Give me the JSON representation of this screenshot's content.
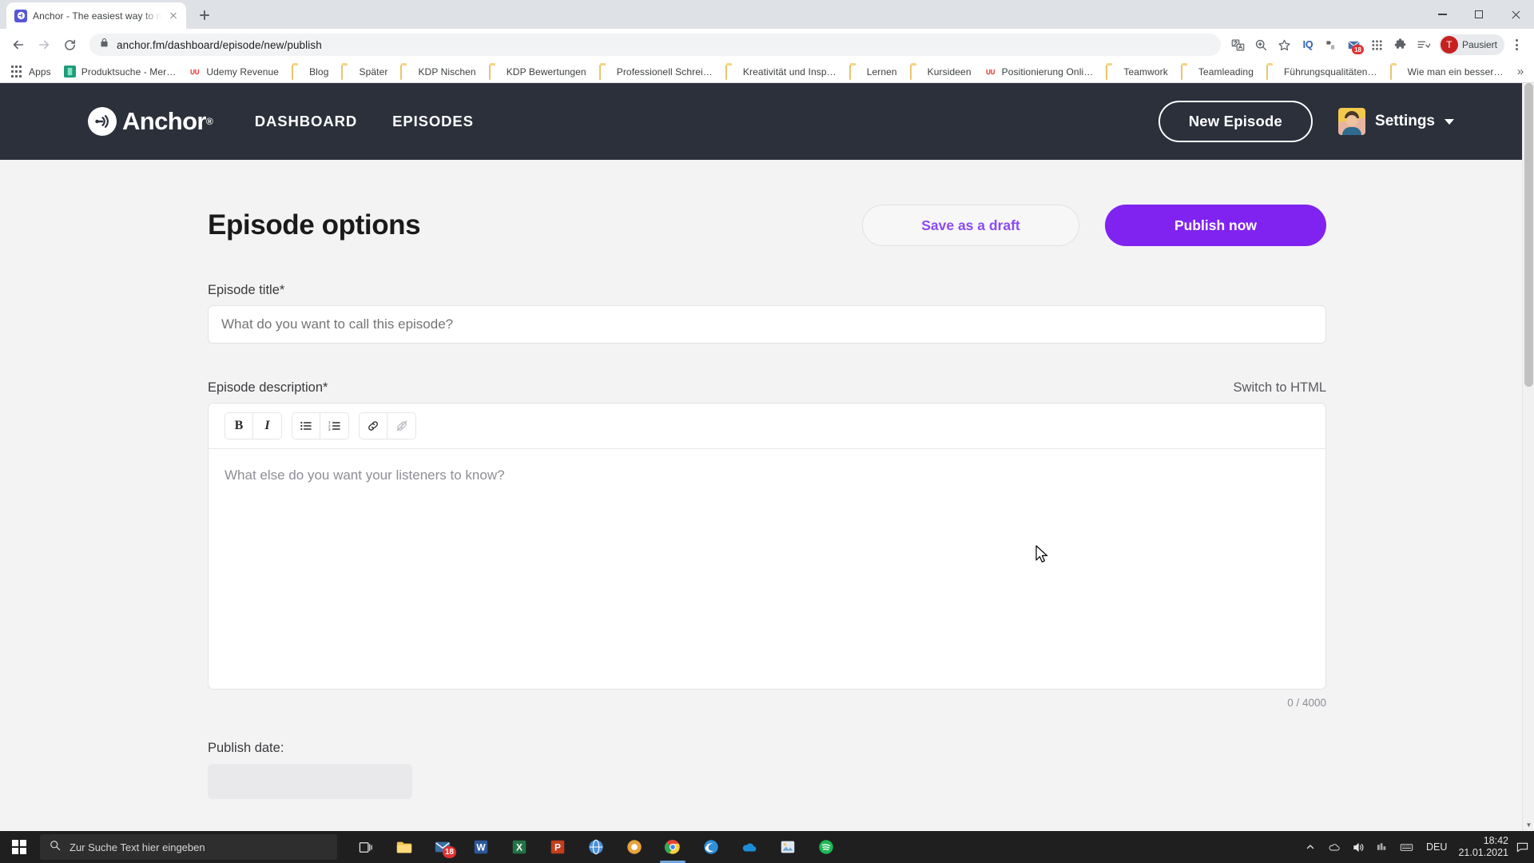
{
  "browser": {
    "tab": {
      "title": "Anchor - The easiest way to mak",
      "favicon": "anchor-icon",
      "close": "close-icon"
    },
    "new_tab_label": "+",
    "window_controls": [
      "minimize",
      "maximize",
      "close"
    ],
    "nav": {
      "back": "back-arrow-icon",
      "forward": "forward-arrow-icon",
      "reload": "reload-icon"
    },
    "omnibox": {
      "lock": "lock-icon",
      "url": "anchor.fm/dashboard/episode/new/publish"
    },
    "toolbar_icons": [
      "translate-icon",
      "zoom-icon",
      "bookmark-star-icon",
      "iq-extension-icon",
      "extension-icon",
      "mail-extension-icon",
      "grid-extension-icon",
      "puzzle-extension-icon",
      "reading-list-icon"
    ],
    "profile": {
      "initial": "T",
      "label": "Pausiert"
    },
    "menu": "three-dot-menu-icon",
    "bookmarks": [
      {
        "label": "Apps",
        "icon": "apps-grid-icon"
      },
      {
        "label": "Produktsuche - Mer…",
        "icon": "site-icon"
      },
      {
        "label": "Udemy Revenue",
        "icon": "udemy-icon"
      },
      {
        "label": "Blog",
        "icon": "folder-icon"
      },
      {
        "label": "Später",
        "icon": "folder-icon"
      },
      {
        "label": "KDP Nischen",
        "icon": "folder-icon"
      },
      {
        "label": "KDP Bewertungen",
        "icon": "folder-icon"
      },
      {
        "label": "Professionell Schrei…",
        "icon": "folder-icon"
      },
      {
        "label": "Kreativität und Insp…",
        "icon": "folder-icon"
      },
      {
        "label": "Lernen",
        "icon": "folder-icon"
      },
      {
        "label": "Kursideen",
        "icon": "folder-icon"
      },
      {
        "label": "Positionierung Onli…",
        "icon": "udemy-icon"
      },
      {
        "label": "Teamwork",
        "icon": "folder-icon"
      },
      {
        "label": "Teamleading",
        "icon": "folder-icon"
      },
      {
        "label": "Führungsqualitäten…",
        "icon": "folder-icon"
      },
      {
        "label": "Wie man ein besser…",
        "icon": "folder-icon"
      }
    ],
    "bookmarks_overflow": "»"
  },
  "site": {
    "brand": {
      "name": "Anchor",
      "registered": "®",
      "logo": "anchor-logo-icon"
    },
    "nav": [
      {
        "label": "DASHBOARD"
      },
      {
        "label": "EPISODES"
      }
    ],
    "new_episode_button": "New Episode",
    "settings": {
      "label": "Settings",
      "caret": "chevron-down-icon",
      "avatar": "user-avatar"
    }
  },
  "page": {
    "title": "Episode options",
    "save_draft_button": "Save as a draft",
    "publish_button": "Publish now",
    "episode_title": {
      "label": "Episode title*",
      "value": "",
      "placeholder": "What do you want to call this episode?"
    },
    "episode_description": {
      "label": "Episode description*",
      "switch_link": "Switch to HTML",
      "value": "",
      "placeholder": "What else do you want your listeners to know?",
      "char_count": "0 / 4000",
      "toolbar": [
        {
          "name": "bold-button",
          "glyph": "B"
        },
        {
          "name": "italic-button",
          "glyph": "I"
        },
        {
          "name": "bullet-list-button",
          "glyph": "bullet-list-icon"
        },
        {
          "name": "numbered-list-button",
          "glyph": "numbered-list-icon"
        },
        {
          "name": "link-button",
          "glyph": "link-icon"
        },
        {
          "name": "unlink-button",
          "glyph": "unlink-icon"
        }
      ]
    },
    "publish_date": {
      "label": "Publish date:",
      "value": ""
    }
  },
  "colors": {
    "header_bg": "#2b303b",
    "publish_purple": "#8023f0",
    "draft_text_purple": "#8b4bf5",
    "page_bg": "#f3f3f4"
  },
  "taskbar": {
    "start": "windows-start-icon",
    "search_placeholder": "Zur Suche Text hier eingeben",
    "search_icon": "search-icon",
    "task_view": "task-view-icon",
    "apps": [
      {
        "name": "file-explorer",
        "badge": ""
      },
      {
        "name": "mail-app",
        "badge": "18"
      },
      {
        "name": "word-app",
        "badge": ""
      },
      {
        "name": "excel-app",
        "badge": ""
      },
      {
        "name": "powerpoint-app",
        "badge": ""
      },
      {
        "name": "browser-app",
        "badge": ""
      },
      {
        "name": "media-app",
        "badge": ""
      },
      {
        "name": "chrome-app",
        "badge": ""
      },
      {
        "name": "edge-app",
        "badge": ""
      },
      {
        "name": "onedrive-app",
        "badge": ""
      },
      {
        "name": "photos-app",
        "badge": ""
      },
      {
        "name": "spotify-app",
        "badge": ""
      }
    ],
    "tray": {
      "chevron": "show-hidden-icons",
      "onedrive": "onedrive-tray-icon",
      "volume": "volume-icon",
      "network": "network-icon",
      "keyboard": "keyboard-icon",
      "language": "DEU",
      "time": "18:42",
      "date": "21.01.2021",
      "notifications": "notification-icon"
    }
  }
}
